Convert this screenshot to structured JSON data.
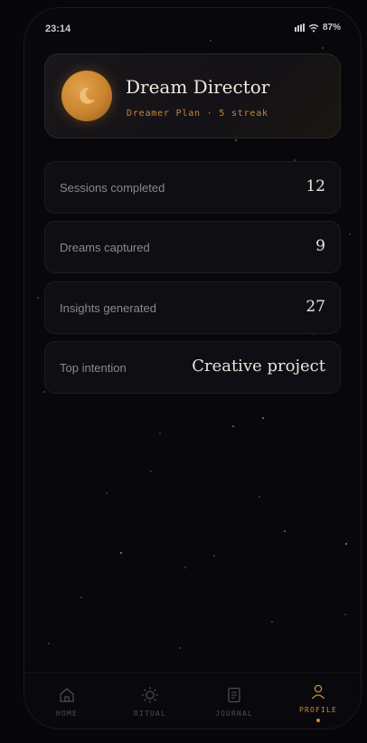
{
  "status_bar": {
    "time": "23:14",
    "battery": "87%",
    "signal_icon": "signal-icon",
    "wifi_icon": "wifi-icon"
  },
  "profile": {
    "name": "Dream Director",
    "subtitle": "Dreamer Plan · 5 streak",
    "avatar_icon": "moon-icon",
    "accent_color": "#c9842e"
  },
  "stats": [
    {
      "label": "Sessions completed",
      "value": "12"
    },
    {
      "label": "Dreams captured",
      "value": "9"
    },
    {
      "label": "Insights generated",
      "value": "27"
    },
    {
      "label": "Top intention",
      "value": "Creative project"
    }
  ],
  "nav": {
    "items": [
      {
        "label": "HOME",
        "icon": "home-icon"
      },
      {
        "label": "RITUAL",
        "icon": "sun-icon"
      },
      {
        "label": "JOURNAL",
        "icon": "journal-icon"
      },
      {
        "label": "PROFILE",
        "icon": "profile-icon"
      }
    ],
    "active": "PROFILE",
    "active_color": "#c98a3c"
  }
}
